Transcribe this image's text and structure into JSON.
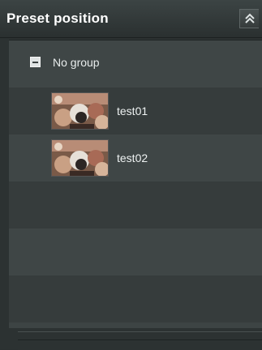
{
  "panel": {
    "title": "Preset position",
    "collapse_icon": "double-chevron-up-icon"
  },
  "tree": {
    "group": {
      "label": "No group",
      "toggle_icon": "minus-icon",
      "expanded": true
    },
    "items": [
      {
        "label": "test01",
        "thumbnail_icon": "camera-preview-thumbnail"
      },
      {
        "label": "test02",
        "thumbnail_icon": "camera-preview-thumbnail"
      }
    ]
  },
  "colors": {
    "panel_bg": "#2c3232",
    "row_light": "#3f4646",
    "row_dark": "#363c3c",
    "text": "#eef2f2"
  }
}
